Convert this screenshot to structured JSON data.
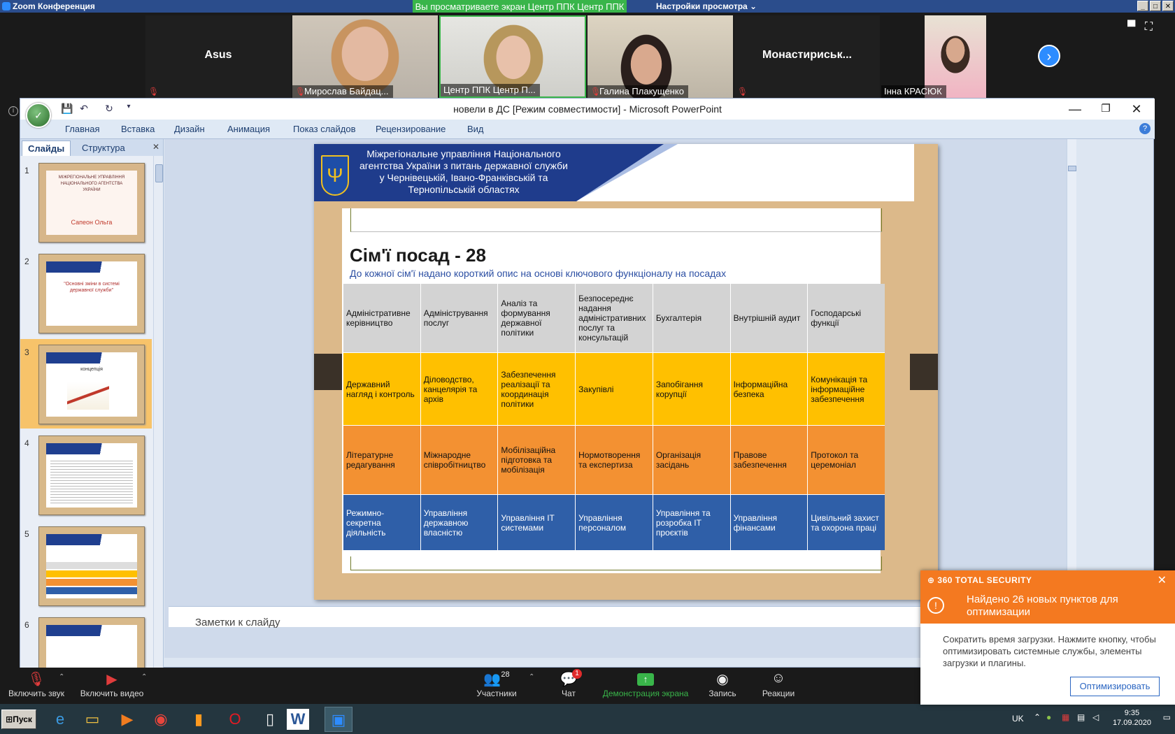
{
  "zoom": {
    "window_title": "Zoom Конференция",
    "share_banner": "Вы просматриваете экран Центр ППК Центр ППК",
    "view_options": "Настройки просмотра",
    "participants": [
      {
        "name": "Asus",
        "muted": true,
        "video": false
      },
      {
        "name": "Мирослав Байдац...",
        "muted": true,
        "video": true
      },
      {
        "name": "Центр ППК Центр П...",
        "muted": false,
        "video": true
      },
      {
        "name": "Галина Плакущенко",
        "muted": true,
        "video": true
      },
      {
        "name": "Монастириськ...",
        "muted": true,
        "video": false
      },
      {
        "name": "Інна КРАСЮК",
        "muted": false,
        "video": true
      }
    ],
    "controls": {
      "unmute": "Включить звук",
      "start_video": "Включить видео",
      "participants": "Участники",
      "participants_count": "28",
      "chat": "Чат",
      "chat_badge": "1",
      "share": "Демонстрация экрана",
      "record": "Запись",
      "reactions": "Реакции"
    }
  },
  "ppt": {
    "window_title": "новели в ДС [Режим совместимости] - Microsoft PowerPoint",
    "tabs": [
      "Главная",
      "Вставка",
      "Дизайн",
      "Анимация",
      "Показ слайдов",
      "Рецензирование",
      "Вид"
    ],
    "pane_tabs": {
      "slides": "Слайды",
      "outline": "Структура"
    },
    "slide_numbers": [
      "1",
      "2",
      "3",
      "4",
      "5",
      "6"
    ],
    "selected_slide": 3,
    "notes_placeholder": "Заметки к слайду",
    "thumb1": {
      "author": "Сапеон Ольга"
    },
    "slide": {
      "agency": "Міжрегіональне управління Національного агентства України з питань державної служби  у Чернівецькій, Івано-Франківській та Тернопільській областях",
      "title": "Сім'ї посад - 28",
      "subtitle": "До кожної сім'ї надано короткий опис на основі ключового функціоналу на посадах",
      "rows": [
        [
          "Адміністративне керівництво",
          "Адміністрування послуг",
          "Аналіз та формування державної політики",
          "Безпосереднє надання адміністративних послуг та консультацій",
          "Бухгалтерія",
          "Внутрішній аудит",
          "Господарські функції"
        ],
        [
          "Державний нагляд і контроль",
          "Діловодство, канцелярія та архів",
          "Забезпечення реалізації та координація політики",
          "Закупівлі",
          "Запобігання корупції",
          "Інформаційна безпека",
          "Комунікація та інформаційне забезпечення"
        ],
        [
          "Літературне редагування",
          "Міжнародне співробітництво",
          "Мобілізаційна підготовка та мобілізація",
          "Нормотворення та експертиза",
          "Організація засідань",
          "Правове забезпечення",
          "Протокол та церемоніал"
        ],
        [
          "Режимно-секретна діяльність",
          "Управління державною власністю",
          "Управління ІТ системами",
          "Управління персоналом",
          "Управління та розробка ІТ проєктів",
          "Управління фінансами",
          "Цивільний захист та охорона праці"
        ]
      ]
    }
  },
  "popup": {
    "brand": "360 TOTAL SECURITY",
    "heading": "Найдено 26 новых пунктов для оптимизации",
    "body": "Сократить время загрузки. Нажмите кнопку, чтобы оптимизировать системные службы, элементы загрузки и плагины.",
    "button": "Оптимизировать"
  },
  "taskbar": {
    "start": "Пуск",
    "lang": "UK",
    "time": "9:35",
    "date": "17.09.2020"
  },
  "colors": {
    "zoom_green": "#39b54a",
    "zoom_blue": "#2d8cff",
    "popup_orange": "#f47920",
    "slide_yellow": "#ffc000",
    "slide_orange": "#f39132",
    "slide_blue": "#2f5fa8"
  }
}
